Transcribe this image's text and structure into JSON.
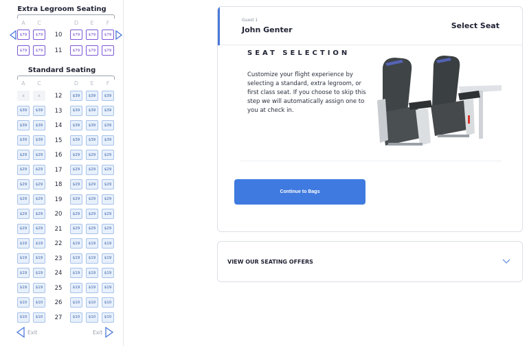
{
  "seatmap": {
    "extra_title": "Extra Legroom Seating",
    "standard_title": "Standard Seating",
    "columns_left": [
      "A",
      "C"
    ],
    "columns_right": [
      "D",
      "E",
      "F"
    ],
    "extra_rows": [
      {
        "row": "10",
        "price": "$79"
      },
      {
        "row": "11",
        "price": "$79"
      }
    ],
    "standard_rows": [
      {
        "row": "12",
        "left": [
          "x",
          "x"
        ],
        "price": "$39"
      },
      {
        "row": "13",
        "price": "$39"
      },
      {
        "row": "14",
        "price": "$39"
      },
      {
        "row": "15",
        "price": "$39"
      },
      {
        "row": "16",
        "price": "$29"
      },
      {
        "row": "17",
        "price": "$29"
      },
      {
        "row": "18",
        "price": "$29"
      },
      {
        "row": "19",
        "price": "$29"
      },
      {
        "row": "20",
        "price": "$29"
      },
      {
        "row": "21",
        "price": "$29"
      },
      {
        "row": "22",
        "price": "$19"
      },
      {
        "row": "23",
        "price": "$19"
      },
      {
        "row": "24",
        "price": "$19"
      },
      {
        "row": "25",
        "price": "$19"
      },
      {
        "row": "26",
        "price": "$10"
      },
      {
        "row": "27",
        "price": "$10"
      }
    ],
    "exit_left": "Exit",
    "exit_right": "Exit"
  },
  "card": {
    "guest_label": "Guest 1",
    "guest_name": "John Genter",
    "select_seat": "Select Seat",
    "section_title": "SEAT SELECTION",
    "description": "Customize your flight experience by selecting a standard, extra legroom, or first class seat. If you choose to skip this step we will automatically assign one to you at check in.",
    "cta_label": "Continue to Bags"
  },
  "offers": {
    "label": "VIEW OUR SEATING OFFERS",
    "chevron_icon": "chevron-down-icon"
  },
  "colors": {
    "accent": "#3f7ae0",
    "legroom": "#7a55d6",
    "standard_fill": "#e7f0fb"
  }
}
